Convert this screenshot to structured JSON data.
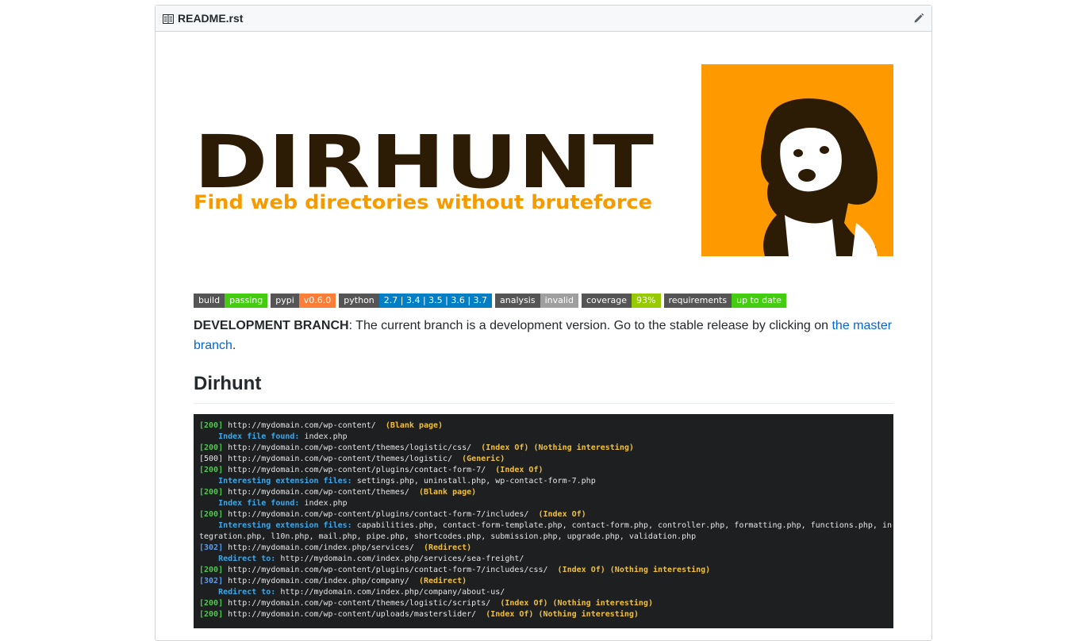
{
  "file_header": {
    "filename": "README.rst",
    "icon": "book-icon",
    "edit_icon": "pencil-icon"
  },
  "logo": {
    "title": "DIRHUNT",
    "tagline": "Find web directories without bruteforce",
    "title_color": "#2d1c05",
    "tagline_color": "#f59a00",
    "dog_bg": "#fe9900"
  },
  "badges": [
    {
      "label": "build",
      "value": "passing",
      "color": "#4c1"
    },
    {
      "label": "pypi",
      "value": "v0.6.0",
      "color": "#fe7d37"
    },
    {
      "label": "python",
      "value": "2.7 | 3.4 | 3.5 | 3.6 | 3.7",
      "color": "#007ec6"
    },
    {
      "label": "analysis",
      "value": "invalid",
      "color": "#9f9f9f"
    },
    {
      "label": "coverage",
      "value": "93%",
      "color": "#97ca00"
    },
    {
      "label": "requirements",
      "value": "up to date",
      "color": "#4c1"
    }
  ],
  "dev_notice": {
    "bold": "DEVELOPMENT BRANCH",
    "text": ": The current branch is a development version. Go to the stable release by clicking on ",
    "link": "the master branch",
    "end": "."
  },
  "heading": "Dirhunt",
  "terminal": {
    "lines": [
      [
        [
          "[200]",
          "g"
        ],
        [
          " http://mydomain.com/wp-content/  ",
          "w"
        ],
        [
          "(Blank page)",
          "y"
        ]
      ],
      [
        [
          "    Index file found: ",
          "c"
        ],
        [
          "index.php",
          "w"
        ]
      ],
      [
        [
          "[200]",
          "g"
        ],
        [
          " http://mydomain.com/wp-content/themes/logistic/css/  ",
          "w"
        ],
        [
          "(Index Of) (Nothing interesting)",
          "y"
        ]
      ],
      [
        [
          "[500]",
          "w"
        ],
        [
          " http://mydomain.com/wp-content/themes/logistic/  ",
          "w"
        ],
        [
          "(Generic)",
          "y"
        ]
      ],
      [
        [
          "[200]",
          "g"
        ],
        [
          " http://mydomain.com/wp-content/plugins/contact-form-7/  ",
          "w"
        ],
        [
          "(Index Of)",
          "y"
        ]
      ],
      [
        [
          "    Interesting extension files: ",
          "c"
        ],
        [
          "settings.php, uninstall.php, wp-contact-form-7.php",
          "w"
        ]
      ],
      [
        [
          "[200]",
          "g"
        ],
        [
          " http://mydomain.com/wp-content/themes/  ",
          "w"
        ],
        [
          "(Blank page)",
          "y"
        ]
      ],
      [
        [
          "    Index file found: ",
          "c"
        ],
        [
          "index.php",
          "w"
        ]
      ],
      [
        [
          "[200]",
          "g"
        ],
        [
          " http://mydomain.com/wp-content/plugins/contact-form-7/includes/  ",
          "w"
        ],
        [
          "(Index Of)",
          "y"
        ]
      ],
      [
        [
          "    Interesting extension files: ",
          "c"
        ],
        [
          "capabilities.php, contact-form-template.php, contact-form.php, controller.php, formatting.php, functions.php, in",
          "w"
        ]
      ],
      [
        [
          "tegration.php, l10n.php, mail.php, pipe.php, shortcodes.php, submission.php, upgrade.php, validation.php",
          "w"
        ]
      ],
      [
        [
          "[302]",
          "b"
        ],
        [
          " http://mydomain.com/index.php/services/  ",
          "w"
        ],
        [
          "(Redirect)",
          "y"
        ]
      ],
      [
        [
          "    Redirect to: ",
          "c"
        ],
        [
          "http://mydomain.com/index.php/services/sea-freight/",
          "w"
        ]
      ],
      [
        [
          "[200]",
          "g"
        ],
        [
          " http://mydomain.com/wp-content/plugins/contact-form-7/includes/css/  ",
          "w"
        ],
        [
          "(Index Of) (Nothing interesting)",
          "y"
        ]
      ],
      [
        [
          "[302]",
          "b"
        ],
        [
          " http://mydomain.com/index.php/company/  ",
          "w"
        ],
        [
          "(Redirect)",
          "y"
        ]
      ],
      [
        [
          "    Redirect to: ",
          "c"
        ],
        [
          "http://mydomain.com/index.php/company/about-us/",
          "w"
        ]
      ],
      [
        [
          "[200]",
          "g"
        ],
        [
          " http://mydomain.com/wp-content/themes/logistic/scripts/  ",
          "w"
        ],
        [
          "(Index Of) (Nothing interesting)",
          "y"
        ]
      ],
      [
        [
          "[200]",
          "g"
        ],
        [
          " http://mydomain.com/wp-content/uploads/masterslider/  ",
          "w"
        ],
        [
          "(Index Of) (Nothing interesting)",
          "y"
        ]
      ]
    ]
  }
}
